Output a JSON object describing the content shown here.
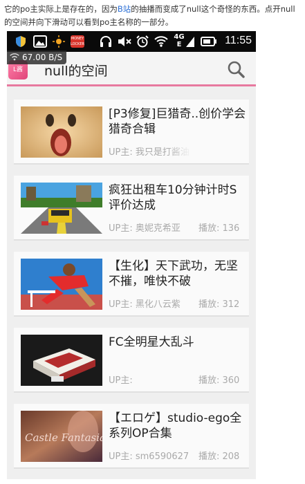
{
  "caption": {
    "part1": "它的po主实际上是存在的，因为",
    "link": "B站",
    "part2": "的抽播而变成了null这个奇怪的东西。点开null的空间并向下滑动可以看到po主名称的一部分。"
  },
  "statusbar": {
    "time": "11:55",
    "net_speed": "67.00 B/S",
    "net_type_top": "4G",
    "net_type_bottom": "E",
    "icons": [
      "shield-icon",
      "gallery-icon",
      "brightness-icon",
      "money-locker-icon",
      "headset-icon",
      "mute-icon",
      "alarm-icon",
      "wifi-icon",
      "signal-icon",
      "battery-icon"
    ],
    "money_locker_label": "MONEY LOCKER"
  },
  "appbar": {
    "logo_text": "L酱",
    "title": "null的空间",
    "accent": "#e7799f"
  },
  "videos": [
    {
      "title": "[P3修复]巨猎奇..创价学会猎奇合辑",
      "uploader": "UP主: 我只是打酱油",
      "plays": ""
    },
    {
      "title": "疯狂出租车10分钟计时S评价达成",
      "uploader": "UP主: 奥妮克希亚",
      "plays": "播放: 136"
    },
    {
      "title": "【生化】天下武功，无坚不摧，唯快不破",
      "uploader": "UP主: 黑化八云紫",
      "plays": "播放: 312"
    },
    {
      "title": "FC全明星大乱斗",
      "uploader": "UP主:",
      "plays": "播放: 360"
    },
    {
      "title": "【エロゲ】studio-ego全系列OP合集",
      "uploader": "UP主: sm6590627",
      "plays": "播放: 208"
    }
  ],
  "thumb5_text": "Castle Fantasia"
}
